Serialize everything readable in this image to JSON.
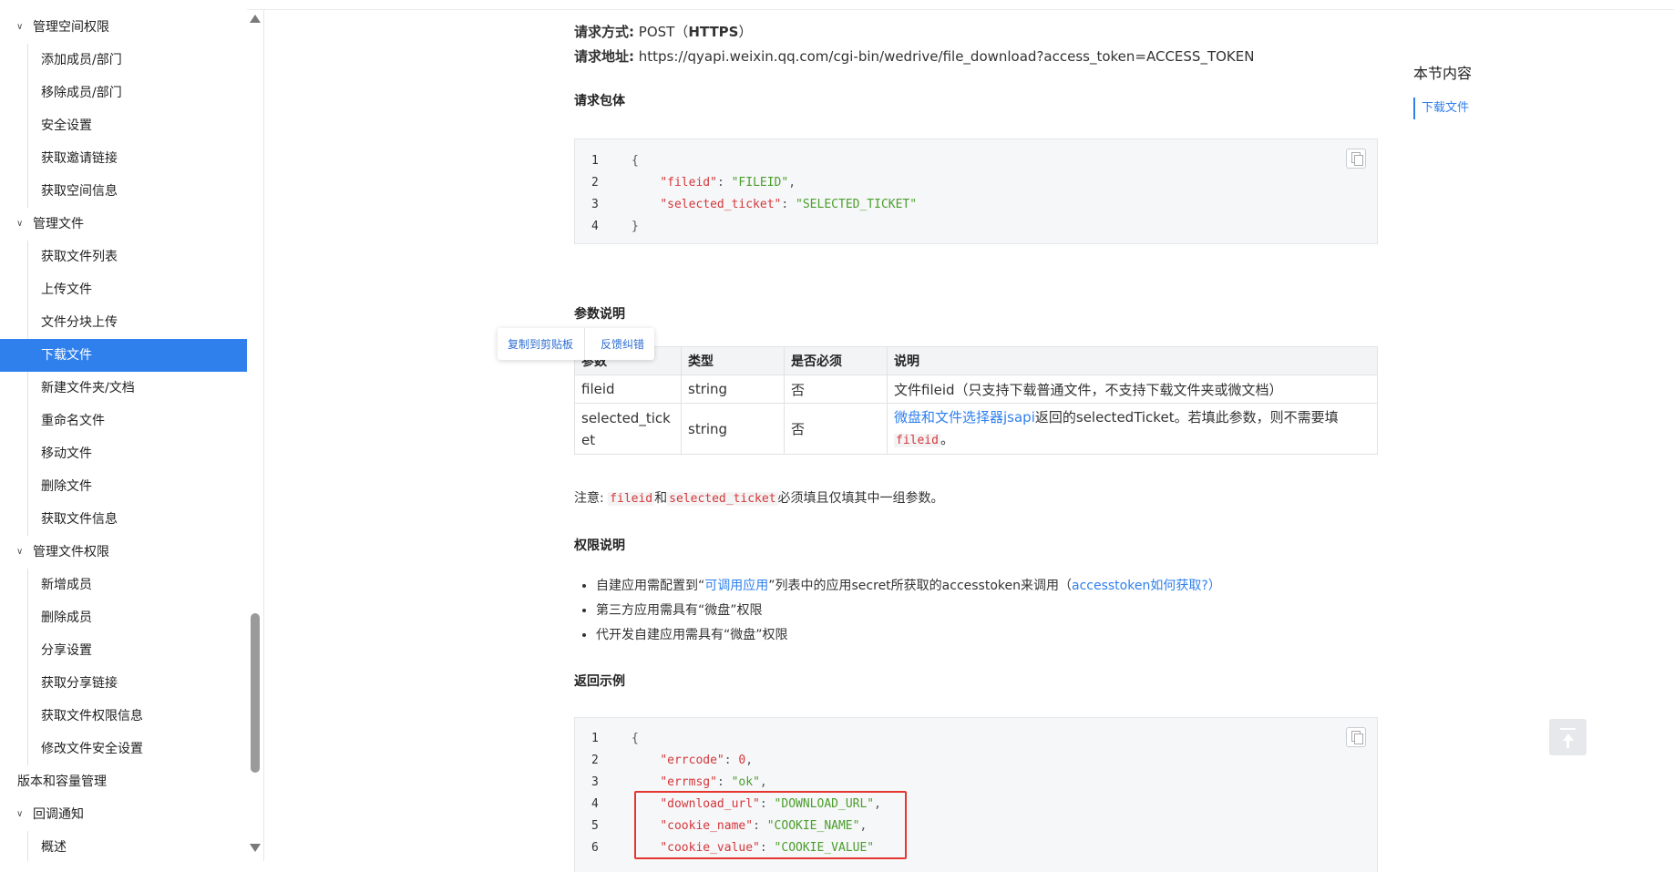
{
  "sidebar": {
    "items": [
      {
        "label": "管理空间权限",
        "level": 1,
        "expanded": true
      },
      {
        "label": "添加成员/部门",
        "level": 2
      },
      {
        "label": "移除成员/部门",
        "level": 2
      },
      {
        "label": "安全设置",
        "level": 2
      },
      {
        "label": "获取邀请链接",
        "level": 2
      },
      {
        "label": "获取空间信息",
        "level": 2
      },
      {
        "label": "管理文件",
        "level": 1,
        "expanded": true
      },
      {
        "label": "获取文件列表",
        "level": 2
      },
      {
        "label": "上传文件",
        "level": 2
      },
      {
        "label": "文件分块上传",
        "level": 2
      },
      {
        "label": "下载文件",
        "level": 2,
        "active": true
      },
      {
        "label": "新建文件夹/文档",
        "level": 2
      },
      {
        "label": "重命名文件",
        "level": 2
      },
      {
        "label": "移动文件",
        "level": 2
      },
      {
        "label": "删除文件",
        "level": 2
      },
      {
        "label": "获取文件信息",
        "level": 2
      },
      {
        "label": "管理文件权限",
        "level": 1,
        "expanded": true
      },
      {
        "label": "新增成员",
        "level": 2
      },
      {
        "label": "删除成员",
        "level": 2
      },
      {
        "label": "分享设置",
        "level": 2
      },
      {
        "label": "获取分享链接",
        "level": 2
      },
      {
        "label": "获取文件权限信息",
        "level": 2
      },
      {
        "label": "修改文件安全设置",
        "level": 2
      },
      {
        "label": "版本和容量管理",
        "level": 0
      },
      {
        "label": "回调通知",
        "level": 1,
        "expanded": true
      },
      {
        "label": "概述",
        "level": 2
      }
    ]
  },
  "request": {
    "method_label": "请求方式:",
    "method_value": " POST（",
    "method_proto": "HTTPS",
    "method_close": "）",
    "url_label": "请求地址:",
    "url_value": " https://qyapi.weixin.qq.com/cgi-bin/wedrive/file_download?access_token=ACCESS_TOKEN"
  },
  "body_heading": "请求包体",
  "body_code": [
    {
      "n": "1",
      "parts": [
        [
          "p",
          "{"
        ]
      ]
    },
    {
      "n": "2",
      "parts": [
        [
          "p",
          "    "
        ],
        [
          "k",
          "\"fileid\""
        ],
        [
          "p",
          ": "
        ],
        [
          "s",
          "\"FILEID\""
        ],
        [
          "p",
          ","
        ]
      ]
    },
    {
      "n": "3",
      "parts": [
        [
          "p",
          "    "
        ],
        [
          "k",
          "\"selected_ticket\""
        ],
        [
          "p",
          ": "
        ],
        [
          "s",
          "\"SELECTED_TICKET\""
        ]
      ]
    },
    {
      "n": "4",
      "parts": [
        [
          "p",
          "}"
        ]
      ]
    }
  ],
  "params_heading": "参数说明",
  "popover": {
    "copy": "复制到剪贴板",
    "feedback": "反馈纠错"
  },
  "params_table": {
    "headers": [
      "参数",
      "类型",
      "是否必须",
      "说明"
    ],
    "rows": [
      {
        "name": "fileid",
        "type": "string",
        "required": "否",
        "desc": "文件fileid（只支持下载普通文件，不支持下载文件夹或微文档）"
      },
      {
        "name": "selected_ticket",
        "type": "string",
        "required": "否",
        "desc_link": "微盘和文件选择器jsapi",
        "desc_text": "返回的selectedTicket。若填此参数，则不需要填",
        "desc_code": "fileid",
        "desc_end": "。"
      }
    ]
  },
  "note": {
    "prefix": "注意: ",
    "code1": "fileid",
    "mid": "和",
    "code2": "selected_ticket",
    "suffix": "必须填且仅填其中一组参数。"
  },
  "perm_heading": "权限说明",
  "perm_items": {
    "item1_a": "自建应用需配置到“",
    "item1_link": "可调用应用",
    "item1_b": "”列表中的应用secret所获取的accesstoken来调用（",
    "item1_link2": "accesstoken如何获取?",
    "item1_c": "）",
    "item2": "第三方应用需具有“微盘”权限",
    "item3": "代开发自建应用需具有“微盘”权限"
  },
  "return_heading": "返回示例",
  "return_code": [
    {
      "n": "1",
      "parts": [
        [
          "p",
          "{"
        ]
      ]
    },
    {
      "n": "2",
      "parts": [
        [
          "p",
          "    "
        ],
        [
          "k",
          "\"errcode\""
        ],
        [
          "p",
          ": "
        ],
        [
          "n",
          "0"
        ],
        [
          "p",
          ","
        ]
      ]
    },
    {
      "n": "3",
      "parts": [
        [
          "p",
          "    "
        ],
        [
          "k",
          "\"errmsg\""
        ],
        [
          "p",
          ": "
        ],
        [
          "s",
          "\"ok\""
        ],
        [
          "p",
          ","
        ]
      ]
    },
    {
      "n": "4",
      "parts": [
        [
          "p",
          "    "
        ],
        [
          "k",
          "\"download_url\""
        ],
        [
          "p",
          ": "
        ],
        [
          "s",
          "\"DOWNLOAD_URL\""
        ],
        [
          "p",
          ","
        ]
      ]
    },
    {
      "n": "5",
      "parts": [
        [
          "p",
          "    "
        ],
        [
          "k",
          "\"cookie_name\""
        ],
        [
          "p",
          ": "
        ],
        [
          "s",
          "\"COOKIE_NAME\""
        ],
        [
          "p",
          ","
        ]
      ]
    },
    {
      "n": "6",
      "parts": [
        [
          "p",
          "    "
        ],
        [
          "k",
          "\"cookie_value\""
        ],
        [
          "p",
          ": "
        ],
        [
          "s",
          "\"COOKIE_VALUE\""
        ]
      ]
    }
  ],
  "toc": {
    "title": "本节内容",
    "items": [
      "下载文件"
    ]
  },
  "colors": {
    "accent": "#2f80ed",
    "highlight": "#e5372f",
    "code_key": "#d4373a",
    "code_string": "#4a9e2a"
  },
  "icons": {
    "copy": "copy-icon",
    "back_to_top": "arrow-up-to-line-icon",
    "chevron": "chevron-down-icon"
  }
}
